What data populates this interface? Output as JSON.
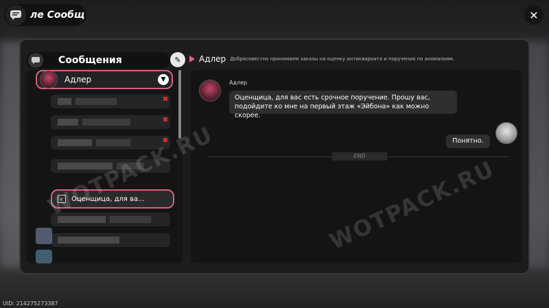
{
  "header": {
    "title": "ле Сообщ",
    "close_icon": "close-icon"
  },
  "sidebar": {
    "title": "Сообщения",
    "contact": {
      "name": "Адлер"
    },
    "active_item": {
      "label": "Оценщица, для ва..."
    }
  },
  "chat": {
    "contact_name": "Адлер",
    "contact_description": "Добросовестно принимаем заказы на оценку антиквариата и поручения по аномалиям.",
    "messages": [
      {
        "sender": "Адлер",
        "text": "Оценщица, для вас есть срочное поручение. Прошу вас, подойдите ко мне на первый этаж «Эйбона» как можно скорее."
      }
    ],
    "reply": "Понятно.",
    "end_label": "END"
  },
  "watermark": "WOTPACK.RU",
  "uid": "UID: 214275273387",
  "colors": {
    "accent": "#d9607a",
    "panel": "#1c1c1d"
  }
}
